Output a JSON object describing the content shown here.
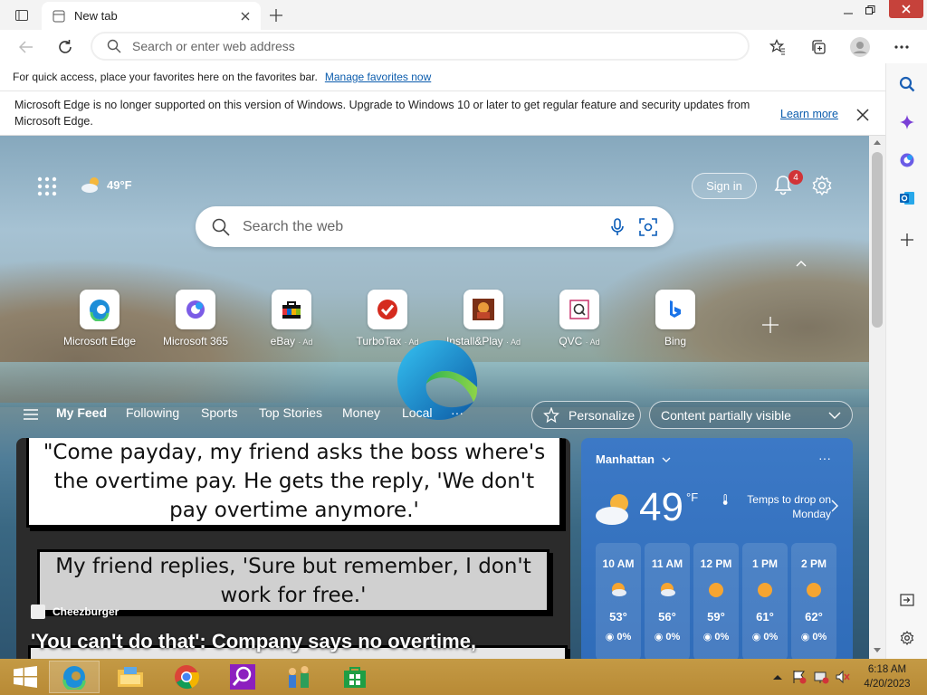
{
  "tab": {
    "title": "New tab"
  },
  "address": {
    "placeholder": "Search or enter web address"
  },
  "favorites_bar": {
    "text": "For quick access, place your favorites here on the favorites bar.",
    "link": "Manage favorites now"
  },
  "info_bar": {
    "message": "Microsoft Edge is no longer supported on this version of Windows. Upgrade to Windows 10 or later to get regular feature and security updates from Microsoft Edge.",
    "link": "Learn more"
  },
  "newtab": {
    "weather_mini": "49°F",
    "sign_in": "Sign in",
    "notifications_count": "4",
    "search_placeholder": "Search the web",
    "quick_links": [
      {
        "label": "Microsoft Edge",
        "ad": ""
      },
      {
        "label": "Microsoft 365",
        "ad": ""
      },
      {
        "label": "eBay",
        "ad": "· Ad"
      },
      {
        "label": "TurboTax",
        "ad": "· Ad"
      },
      {
        "label": "Install&Play",
        "ad": "· Ad"
      },
      {
        "label": "QVC",
        "ad": "· Ad"
      },
      {
        "label": "Bing",
        "ad": ""
      }
    ],
    "feed_tabs": [
      "My Feed",
      "Following",
      "Sports",
      "Top Stories",
      "Money",
      "Local",
      "···"
    ],
    "personalize": "Personalize",
    "content_visibility": "Content partially visible"
  },
  "article": {
    "caption1": "\"Come payday, my friend asks the boss where's the overtime pay. He gets the reply, 'We don't pay overtime anymore.'",
    "caption2": "My friend replies, 'Sure but remember, I don't work for free.'",
    "source": "Cheezburger",
    "headline": "'You can't do that': Company says no overtime,"
  },
  "weather": {
    "city": "Manhattan",
    "temp": "49",
    "unit": "°F",
    "note": "Temps to drop on Monday",
    "hours": [
      {
        "time": "10 AM",
        "temp": "53°",
        "precip": "0%"
      },
      {
        "time": "11 AM",
        "temp": "56°",
        "precip": "0%"
      },
      {
        "time": "12 PM",
        "temp": "59°",
        "precip": "0%"
      },
      {
        "time": "1 PM",
        "temp": "61°",
        "precip": "0%"
      },
      {
        "time": "2 PM",
        "temp": "62°",
        "precip": "0%"
      }
    ]
  },
  "clock": {
    "time": "6:18 AM",
    "date": "4/20/2023"
  },
  "colors": {
    "accent": "#0b5cad",
    "weather_card": "#3571c0",
    "taskbar": "#c49a45"
  }
}
